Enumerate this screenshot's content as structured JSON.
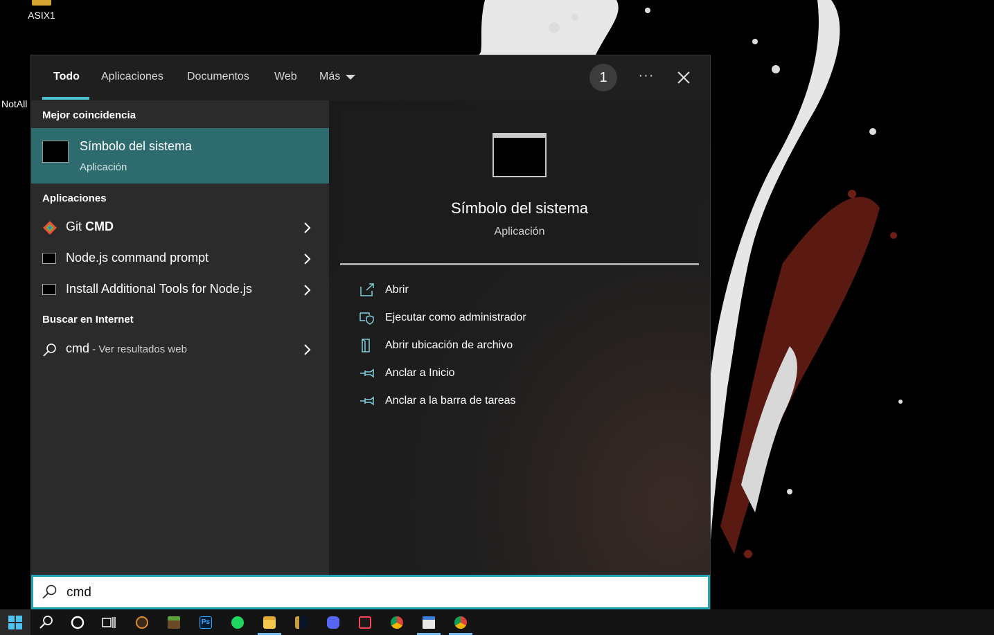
{
  "desktop": {
    "icons": [
      {
        "label": "ASIX1"
      }
    ],
    "partial_label": "NotAll"
  },
  "search": {
    "tabs": [
      {
        "label": "Todo",
        "active": true
      },
      {
        "label": "Aplicaciones"
      },
      {
        "label": "Documentos"
      },
      {
        "label": "Web"
      },
      {
        "label": "Más"
      }
    ],
    "badge_count": "1",
    "more_label": "···",
    "query": "cmd"
  },
  "results": {
    "best_match_header": "Mejor coincidencia",
    "best_match": {
      "title": "Símbolo del sistema",
      "subtitle": "Aplicación"
    },
    "apps_header": "Aplicaciones",
    "apps": [
      {
        "prefix": "Git ",
        "bold": "CMD",
        "icon": "git-icon"
      },
      {
        "prefix": "Node.js command prompt",
        "bold": "",
        "icon": "console-icon"
      },
      {
        "prefix": "Install Additional Tools for Node.js",
        "bold": "",
        "icon": "console-icon"
      }
    ],
    "web_header": "Buscar en Internet",
    "web": {
      "term": "cmd",
      "suffix": " - Ver resultados web"
    }
  },
  "preview": {
    "title": "Símbolo del sistema",
    "subtitle": "Aplicación",
    "actions": [
      {
        "label": "Abrir",
        "icon": "open-icon"
      },
      {
        "label": "Ejecutar como administrador",
        "icon": "admin-shield-icon"
      },
      {
        "label": "Abrir ubicación de archivo",
        "icon": "file-location-icon"
      },
      {
        "label": "Anclar a Inicio",
        "icon": "pin-icon"
      },
      {
        "label": "Anclar a la barra de tareas",
        "icon": "pin-icon"
      }
    ]
  },
  "colors": {
    "accent": "#4cc2d1",
    "selection": "#2e6b6f",
    "taskbar": "#141414",
    "flyout": "#2b2b2b"
  },
  "taskbar": {
    "items": [
      {
        "name": "start-button",
        "icon": "windows-icon"
      },
      {
        "name": "search-button",
        "icon": "search-icon"
      },
      {
        "name": "cortana-button",
        "icon": "cortana-icon"
      },
      {
        "name": "task-view-button",
        "icon": "task-view-icon"
      },
      {
        "name": "app-1",
        "icon": "app-icon"
      },
      {
        "name": "app-minecraft",
        "icon": "minecraft-icon"
      },
      {
        "name": "app-photoshop",
        "icon": "photoshop-icon"
      },
      {
        "name": "app-spotify",
        "icon": "spotify-icon"
      },
      {
        "name": "app-file-explorer",
        "icon": "folder-icon",
        "running": true
      },
      {
        "name": "app-league",
        "icon": "league-icon"
      },
      {
        "name": "app-discord",
        "icon": "discord-icon"
      },
      {
        "name": "app-valorant",
        "icon": "valorant-icon"
      },
      {
        "name": "app-chrome",
        "icon": "chrome-icon"
      },
      {
        "name": "app-window",
        "icon": "window-icon",
        "running": true
      },
      {
        "name": "app-chrome-2",
        "icon": "chrome-icon",
        "running": true
      }
    ]
  }
}
